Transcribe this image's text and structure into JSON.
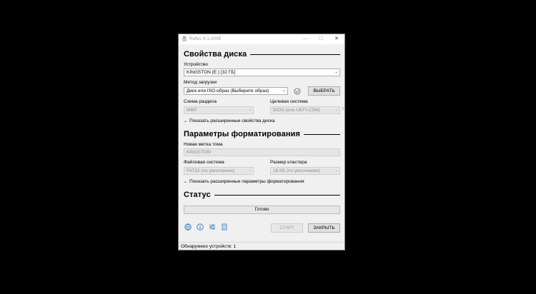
{
  "window": {
    "title": "Rufus 4.1.2045",
    "minimize": "—",
    "maximize": "☐",
    "close": "✕"
  },
  "drive_properties": {
    "heading": "Свойства диска",
    "device_label": "Устройство",
    "device_value": "KINGSTON (E:) [32 ГБ]",
    "boot_label": "Метод загрузки",
    "boot_value": "Диск или ISO-образ (Выберите образ)",
    "select_button": "ВЫБРАТЬ",
    "partition_label": "Схема раздела",
    "partition_value": "MBR",
    "target_label": "Целевая система",
    "target_value": "BIOS (или UEFI-CSM)",
    "target_help": "?",
    "advanced_toggle": "Показать расширенные свойства диска"
  },
  "format_options": {
    "heading": "Параметры форматирования",
    "volume_label": "Новая метка тома",
    "volume_value": "KINGSTON",
    "fs_label": "Файловая система",
    "fs_value": "FAT32 (по умолчанию)",
    "cluster_label": "Размер кластера",
    "cluster_value": "16 КБ (по умолчанию)",
    "advanced_toggle": "Показать расширенные параметры форматирования"
  },
  "status": {
    "heading": "Статус",
    "text": "Готово"
  },
  "buttons": {
    "start": "СТАРТ",
    "close": "ЗАКРЫТЬ"
  },
  "footer": {
    "text": "Обнаружено устройств: 1"
  },
  "colors": {
    "accent": "#1a6fc4",
    "background": "#f0f0f0"
  }
}
